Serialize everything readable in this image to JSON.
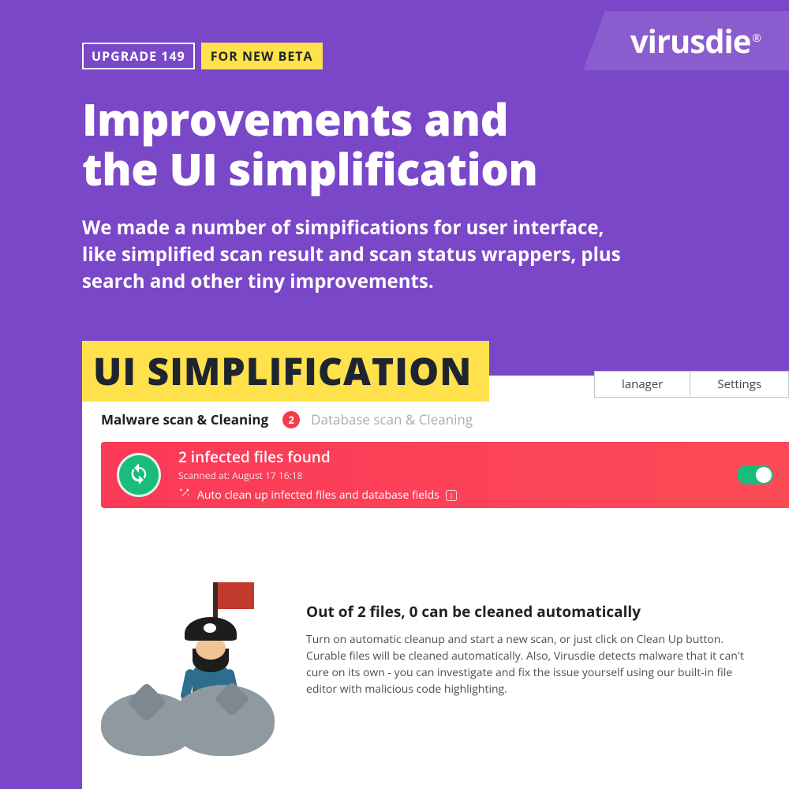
{
  "brand": {
    "name": "virusdie",
    "reg": "®"
  },
  "badges": {
    "upgrade": "UPGRADE 149",
    "beta": "FOR NEW BETA"
  },
  "headline": "Improvements and\nthe UI simplification",
  "sub": "We made a number of simpifications for user interface, like simplified scan result and scan status wrappers, plus search and other tiny improvements.",
  "section_label": "UI SIMPLIFICATION",
  "app": {
    "topbar": {
      "manager": "lanager",
      "settings": "Settings"
    },
    "subtabs": {
      "active": "Malware scan & Cleaning",
      "count": "2",
      "inactive": "Database scan & Cleaning"
    },
    "alert": {
      "title": "2 infected files found",
      "scanned_at": "Scanned at: August 17 16:18",
      "auto_label": "Auto clean up infected files and database fields",
      "info_glyph": "i",
      "toggle_on": true
    },
    "detail": {
      "title": "Out of 2 files, 0 can be cleaned automatically",
      "body": "Turn on automatic cleanup and start a new scan, or just click on Clean Up button. Curable files will be cleaned automatically. Also, Virusdie detects malware that it can't cure on its own - you can investigate and fix the issue yourself using our built-in file editor with malicious code highlighting."
    }
  }
}
